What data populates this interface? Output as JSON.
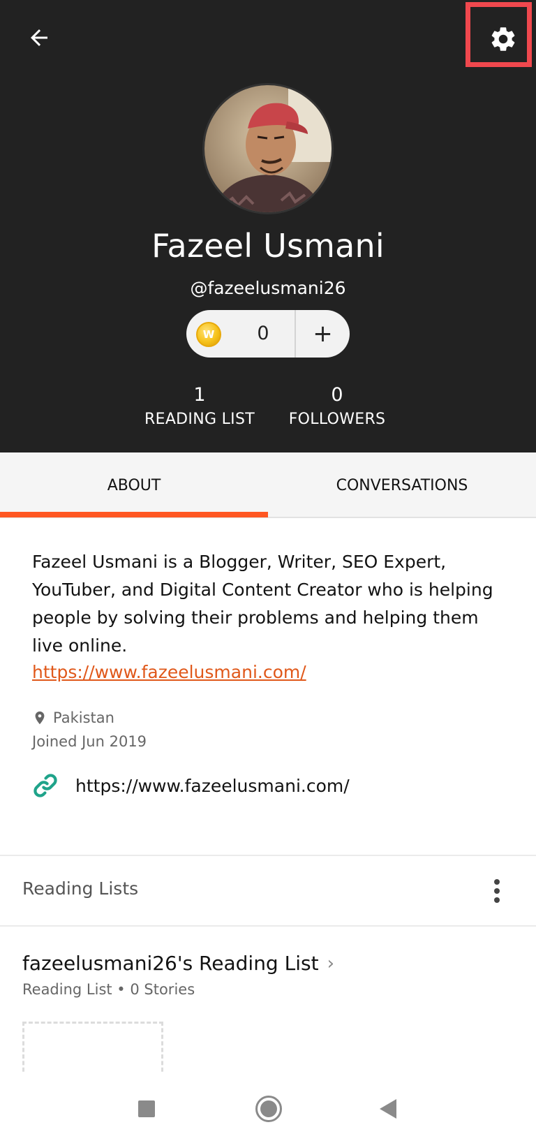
{
  "header": {
    "back_icon": "arrow-left-icon",
    "settings_icon": "gear-icon"
  },
  "profile": {
    "name": "Fazeel Usmani",
    "username": "@fazeelusmani26",
    "coin_icon_letter": "W",
    "coins": "0",
    "coin_add": "+",
    "stats": {
      "reading_list_count": "1",
      "reading_list_label": "READING LIST",
      "followers_count": "0",
      "followers_label": "FOLLOWERS"
    }
  },
  "tabs": {
    "about": "ABOUT",
    "conversations": "CONVERSATIONS",
    "active": "about",
    "accent": "#ff5722"
  },
  "about": {
    "bio": "Fazeel Usmani is a Blogger, Writer, SEO Expert, YouTuber, and Digital Content Creator who is helping people by solving their problems and helping them live online.",
    "bio_link": "https://www.fazeelusmani.com/",
    "location": "Pakistan",
    "joined": "Joined Jun 2019",
    "website": "https://www.fazeelusmani.com/"
  },
  "reading_lists": {
    "header": "Reading Lists",
    "items": [
      {
        "title": "fazeelusmani26's Reading List",
        "subtitle": "Reading List • 0 Stories"
      }
    ]
  },
  "colors": {
    "header_bg": "#222222",
    "link_orange": "#e0581a",
    "link_icon_teal": "#1fa38a",
    "highlight_red": "#f0484e"
  }
}
